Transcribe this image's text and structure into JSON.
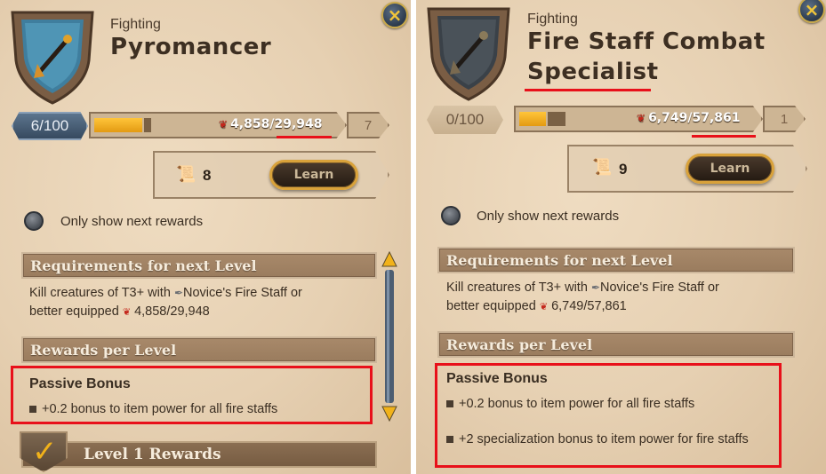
{
  "left": {
    "category": "Fighting",
    "title": "Pyromancer",
    "close_label": "×",
    "level": "6/100",
    "progress": 0.12,
    "fame_current": "4,858",
    "fame_slash": "/",
    "fame_total": "29,948",
    "next_level": "7",
    "books": "8",
    "learn_label": "Learn",
    "only_next_label": "Only show next rewards",
    "requirements_header": "Requirements for next Level",
    "req_line1_prefix": "Kill creatures of T3+ with ",
    "req_item": "Novice's Fire Staff or",
    "req_line2_prefix": "better equipped ",
    "req_fame": "4,858/29,948",
    "rewards_header": "Rewards per Level",
    "passive_title": "Passive Bonus",
    "bonuses": [
      "+0.2 bonus to item power for all fire staffs"
    ],
    "level_rewards": "Level 1 Rewards"
  },
  "right": {
    "category": "Fighting",
    "title_line1": "Fire Staff Combat",
    "title_line2": "Specialist",
    "close_label": "×",
    "level": "0/100",
    "progress": 0.12,
    "fame_current": "6,749",
    "fame_slash": "/",
    "fame_total": "57,861",
    "next_level": "1",
    "books": "9",
    "learn_label": "Learn",
    "only_next_label": "Only show next rewards",
    "requirements_header": "Requirements for next Level",
    "req_line1_prefix": "Kill creatures of T3+ with ",
    "req_item": "Novice's Fire Staff or",
    "req_line2_prefix": "better equipped ",
    "req_fame": "6,749/57,861",
    "rewards_header": "Rewards per Level",
    "passive_title": "Passive Bonus",
    "bonuses": [
      "+0.2 bonus to item power for all fire staffs",
      "+2 specialization bonus to item power for fire staffs"
    ]
  },
  "icons": {
    "fame": "fame-icon",
    "book": "tome-icon",
    "staff": "fire-staff-icon",
    "close": "close-icon",
    "check": "checkmark-icon"
  },
  "colors": {
    "highlight": "#e8101a",
    "progress_fill": "#ffc53a",
    "fame": "#c4271c"
  }
}
